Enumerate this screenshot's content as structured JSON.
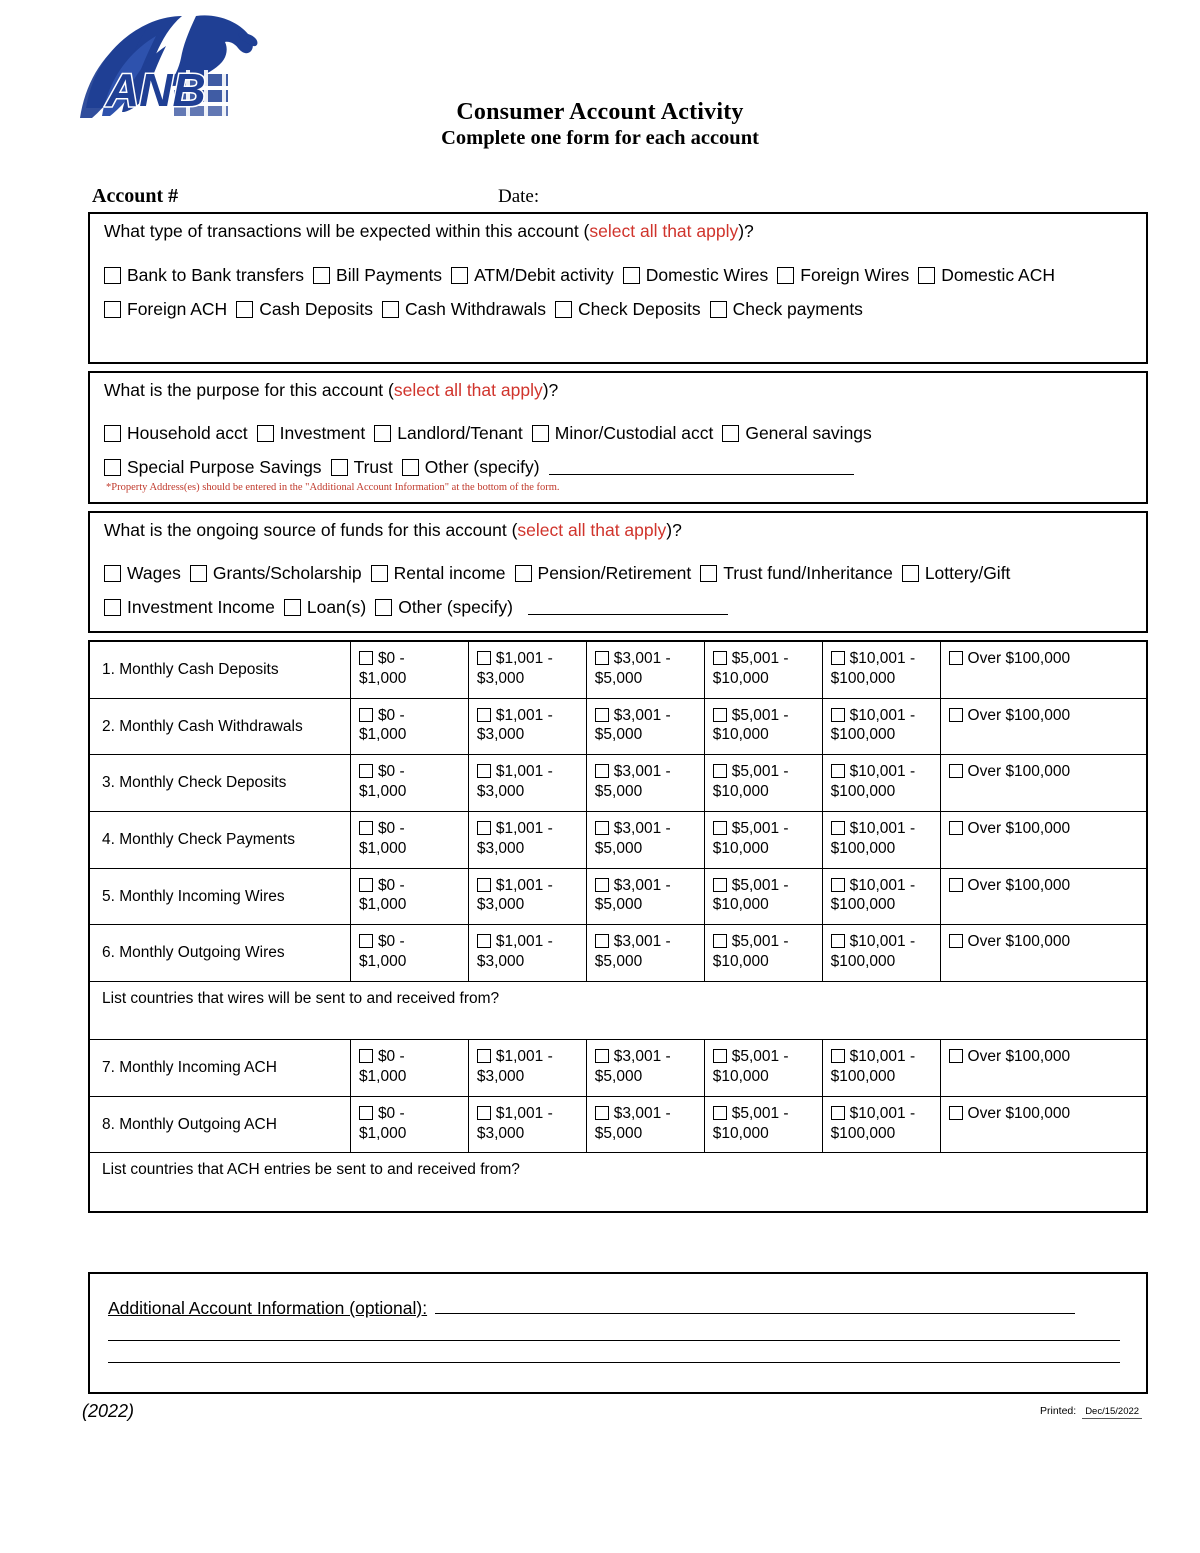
{
  "brand": {
    "logo_text": "ANB",
    "logo_color": "#1f3f94"
  },
  "header": {
    "title": "Consumer Account Activity",
    "subtitle": "Complete one form for each account",
    "account_label": "Account #",
    "date_label": "Date:"
  },
  "colors": {
    "accent_red": "#d0342c",
    "rule": "#000000"
  },
  "section_transactions": {
    "question_pre": "What type of transactions will be expected within this account (",
    "question_accent": "select all that apply",
    "question_post": ")?",
    "row1": [
      "Bank to Bank transfers",
      "Bill Payments",
      "ATM/Debit activity",
      "Domestic Wires",
      "Foreign Wires",
      "Domestic ACH"
    ],
    "row2": [
      "Foreign ACH",
      "Cash Deposits",
      "Cash Withdrawals",
      "Check Deposits",
      "Check payments"
    ]
  },
  "section_purpose": {
    "question_pre": "What is the purpose for this account (",
    "question_accent": "select all that apply",
    "question_post": ")?",
    "row1": [
      "Household acct",
      "Investment",
      "Landlord/Tenant",
      "Minor/Custodial acct",
      "General savings"
    ],
    "row2": [
      "Special Purpose Savings",
      "Trust"
    ],
    "other_label": "Other  (specify)",
    "footnote": "*Property Address(es) should be entered in the \"Additional Account Information\" at the bottom of the form."
  },
  "section_source": {
    "question_pre": "What is the ongoing source of funds for this account (",
    "question_accent": "select all that apply",
    "question_post": ")?",
    "row1": [
      "Wages",
      "Grants/Scholarship",
      "Rental income",
      "Pension/Retirement",
      "Trust fund/Inheritance",
      "Lottery/Gift"
    ],
    "row2": [
      "Investment Income",
      "Loan(s)"
    ],
    "other_label": "Other (specify)"
  },
  "amount_options": [
    {
      "l1": "$0 -",
      "l2": "$1,000"
    },
    {
      "l1": "$1,001 -",
      "l2": "$3,000"
    },
    {
      "l1": "$3,001 -",
      "l2": "$5,000"
    },
    {
      "l1": "$5,001 -",
      "l2": "$10,000"
    },
    {
      "l1": "$10,001 -",
      "l2": "$100,000"
    },
    {
      "l1": "Over $100,000",
      "l2": ""
    }
  ],
  "activity_rows": [
    {
      "label": "1. Monthly Cash Deposits"
    },
    {
      "label": "2. Monthly Cash Withdrawals"
    },
    {
      "label": "3. Monthly Check Deposits"
    },
    {
      "label": "4. Monthly Check Payments"
    },
    {
      "label": "5. Monthly Incoming Wires"
    },
    {
      "label": "6. Monthly Outgoing Wires"
    },
    {
      "label": "7. Monthly Incoming ACH"
    },
    {
      "label": "8. Monthly Outgoing ACH"
    }
  ],
  "countries_wires": "List countries that wires will be sent to and received from?",
  "countries_ach": "List countries that ACH entries be sent to and received from?",
  "additional": {
    "label": "Additional Account Information (optional):"
  },
  "footer": {
    "year": "(2022)",
    "printed_label": "Printed:",
    "printed_date": "Dec/15/2022"
  }
}
